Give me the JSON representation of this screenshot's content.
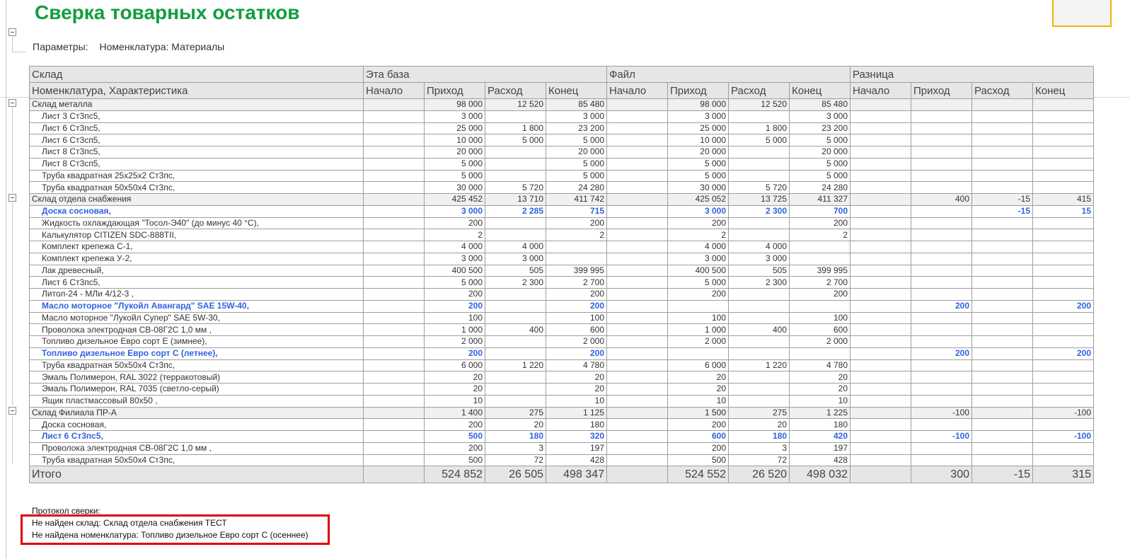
{
  "title": "Сверка товарных остатков",
  "params": {
    "label": "Параметры:",
    "value": "Номенклатура: Материалы"
  },
  "header": {
    "row1": [
      "Склад",
      "Эта база",
      "Файл",
      "Разница"
    ],
    "row2": [
      "Номенклатура, Характеристика",
      "Начало",
      "Приход",
      "Расход",
      "Конец",
      "Начало",
      "Приход",
      "Расход",
      "Конец",
      "Начало",
      "Приход",
      "Расход",
      "Конец"
    ]
  },
  "rows": [
    {
      "type": "group",
      "name": "Склад металла",
      "base": [
        "",
        "98 000",
        "12 520",
        "85 480"
      ],
      "file": [
        "",
        "98 000",
        "12 520",
        "85 480"
      ],
      "diff": [
        "",
        "",
        "",
        ""
      ]
    },
    {
      "type": "item",
      "name": "Лист 3 Ст3пс5,",
      "base": [
        "",
        "3 000",
        "",
        "3 000"
      ],
      "file": [
        "",
        "3 000",
        "",
        "3 000"
      ],
      "diff": [
        "",
        "",
        "",
        ""
      ]
    },
    {
      "type": "item",
      "name": "Лист 6 Ст3пс5,",
      "base": [
        "",
        "25 000",
        "1 800",
        "23 200"
      ],
      "file": [
        "",
        "25 000",
        "1 800",
        "23 200"
      ],
      "diff": [
        "",
        "",
        "",
        ""
      ]
    },
    {
      "type": "item",
      "name": "Лист 6 Ст3сп5,",
      "base": [
        "",
        "10 000",
        "5 000",
        "5 000"
      ],
      "file": [
        "",
        "10 000",
        "5 000",
        "5 000"
      ],
      "diff": [
        "",
        "",
        "",
        ""
      ]
    },
    {
      "type": "item",
      "name": "Лист 8 Ст3пс5,",
      "base": [
        "",
        "20 000",
        "",
        "20 000"
      ],
      "file": [
        "",
        "20 000",
        "",
        "20 000"
      ],
      "diff": [
        "",
        "",
        "",
        ""
      ]
    },
    {
      "type": "item",
      "name": "Лист 8 Ст3сп5,",
      "base": [
        "",
        "5 000",
        "",
        "5 000"
      ],
      "file": [
        "",
        "5 000",
        "",
        "5 000"
      ],
      "diff": [
        "",
        "",
        "",
        ""
      ]
    },
    {
      "type": "item",
      "name": "Труба квадратная 25х25х2 Ст3пс,",
      "base": [
        "",
        "5 000",
        "",
        "5 000"
      ],
      "file": [
        "",
        "5 000",
        "",
        "5 000"
      ],
      "diff": [
        "",
        "",
        "",
        ""
      ]
    },
    {
      "type": "item",
      "name": "Труба квадратная 50х50х4 Ст3пс,",
      "base": [
        "",
        "30 000",
        "5 720",
        "24 280"
      ],
      "file": [
        "",
        "30 000",
        "5 720",
        "24 280"
      ],
      "diff": [
        "",
        "",
        "",
        ""
      ]
    },
    {
      "type": "group",
      "name": "Склад отдела снабжения",
      "base": [
        "",
        "425 452",
        "13 710",
        "411 742"
      ],
      "file": [
        "",
        "425 052",
        "13 725",
        "411 327"
      ],
      "diff": [
        "",
        "400",
        "-15",
        "415"
      ]
    },
    {
      "type": "item",
      "hl": true,
      "name": "Доска сосновая,",
      "base": [
        "",
        "3 000",
        "2 285",
        "715"
      ],
      "file": [
        "",
        "3 000",
        "2 300",
        "700"
      ],
      "diff": [
        "",
        "",
        "-15",
        "15"
      ]
    },
    {
      "type": "item",
      "name": "Жидкость охлаждающая \"Тосол-Э40\" (до минус 40 °С),",
      "base": [
        "",
        "200",
        "",
        "200"
      ],
      "file": [
        "",
        "200",
        "",
        "200"
      ],
      "diff": [
        "",
        "",
        "",
        ""
      ]
    },
    {
      "type": "item",
      "name": "Калькулятор CITIZEN SDC-888TII,",
      "base": [
        "",
        "2",
        "",
        "2"
      ],
      "file": [
        "",
        "2",
        "",
        "2"
      ],
      "diff": [
        "",
        "",
        "",
        ""
      ]
    },
    {
      "type": "item",
      "name": "Комплект крепежа С-1,",
      "base": [
        "",
        "4 000",
        "4 000",
        ""
      ],
      "file": [
        "",
        "4 000",
        "4 000",
        ""
      ],
      "diff": [
        "",
        "",
        "",
        ""
      ]
    },
    {
      "type": "item",
      "name": "Комплект крепежа У-2,",
      "base": [
        "",
        "3 000",
        "3 000",
        ""
      ],
      "file": [
        "",
        "3 000",
        "3 000",
        ""
      ],
      "diff": [
        "",
        "",
        "",
        ""
      ]
    },
    {
      "type": "item",
      "name": "Лак древесный,",
      "base": [
        "",
        "400 500",
        "505",
        "399 995"
      ],
      "file": [
        "",
        "400 500",
        "505",
        "399 995"
      ],
      "diff": [
        "",
        "",
        "",
        ""
      ]
    },
    {
      "type": "item",
      "name": "Лист 6 Ст3пс5,",
      "base": [
        "",
        "5 000",
        "2 300",
        "2 700"
      ],
      "file": [
        "",
        "5 000",
        "2 300",
        "2 700"
      ],
      "diff": [
        "",
        "",
        "",
        ""
      ]
    },
    {
      "type": "item",
      "name": "Литол-24 - МЛи 4/12-3 ,",
      "base": [
        "",
        "200",
        "",
        "200"
      ],
      "file": [
        "",
        "200",
        "",
        "200"
      ],
      "diff": [
        "",
        "",
        "",
        ""
      ]
    },
    {
      "type": "item",
      "hl": true,
      "name": "Масло моторное \"Лукойл Авангард\" SAE 15W-40,",
      "base": [
        "",
        "200",
        "",
        "200"
      ],
      "file": [
        "",
        "",
        "",
        ""
      ],
      "diff": [
        "",
        "200",
        "",
        "200"
      ]
    },
    {
      "type": "item",
      "name": "Масло моторное \"Лукойл Супер\" SAE 5W-30,",
      "base": [
        "",
        "100",
        "",
        "100"
      ],
      "file": [
        "",
        "100",
        "",
        "100"
      ],
      "diff": [
        "",
        "",
        "",
        ""
      ]
    },
    {
      "type": "item",
      "name": "Проволока электродная СВ-08Г2С 1,0 мм ,",
      "base": [
        "",
        "1 000",
        "400",
        "600"
      ],
      "file": [
        "",
        "1 000",
        "400",
        "600"
      ],
      "diff": [
        "",
        "",
        "",
        ""
      ]
    },
    {
      "type": "item",
      "name": "Топливо дизельное Евро сорт Е (зимнее),",
      "base": [
        "",
        "2 000",
        "",
        "2 000"
      ],
      "file": [
        "",
        "2 000",
        "",
        "2 000"
      ],
      "diff": [
        "",
        "",
        "",
        ""
      ]
    },
    {
      "type": "item",
      "hl": true,
      "name": "Топливо дизельное Евро сорт С (летнее),",
      "base": [
        "",
        "200",
        "",
        "200"
      ],
      "file": [
        "",
        "",
        "",
        ""
      ],
      "diff": [
        "",
        "200",
        "",
        "200"
      ]
    },
    {
      "type": "item",
      "name": "Труба квадратная 50х50х4 Ст3пс,",
      "base": [
        "",
        "6 000",
        "1 220",
        "4 780"
      ],
      "file": [
        "",
        "6 000",
        "1 220",
        "4 780"
      ],
      "diff": [
        "",
        "",
        "",
        ""
      ]
    },
    {
      "type": "item",
      "name": "Эмаль Полимерон, RAL 3022 (терракотовый)",
      "base": [
        "",
        "20",
        "",
        "20"
      ],
      "file": [
        "",
        "20",
        "",
        "20"
      ],
      "diff": [
        "",
        "",
        "",
        ""
      ]
    },
    {
      "type": "item",
      "name": "Эмаль Полимерон, RAL 7035 (светло-серый)",
      "base": [
        "",
        "20",
        "",
        "20"
      ],
      "file": [
        "",
        "20",
        "",
        "20"
      ],
      "diff": [
        "",
        "",
        "",
        ""
      ]
    },
    {
      "type": "item",
      "name": "Ящик пластмассовый 80х50 ,",
      "base": [
        "",
        "10",
        "",
        "10"
      ],
      "file": [
        "",
        "10",
        "",
        "10"
      ],
      "diff": [
        "",
        "",
        "",
        ""
      ]
    },
    {
      "type": "group",
      "name": "Склад Филиала ПР-А",
      "base": [
        "",
        "1 400",
        "275",
        "1 125"
      ],
      "file": [
        "",
        "1 500",
        "275",
        "1 225"
      ],
      "diff": [
        "",
        "-100",
        "",
        "-100"
      ]
    },
    {
      "type": "item",
      "name": "Доска сосновая,",
      "base": [
        "",
        "200",
        "20",
        "180"
      ],
      "file": [
        "",
        "200",
        "20",
        "180"
      ],
      "diff": [
        "",
        "",
        "",
        ""
      ]
    },
    {
      "type": "item",
      "hl": true,
      "name": "Лист 6 Ст3пс5,",
      "base": [
        "",
        "500",
        "180",
        "320"
      ],
      "file": [
        "",
        "600",
        "180",
        "420"
      ],
      "diff": [
        "",
        "-100",
        "",
        "-100"
      ]
    },
    {
      "type": "item",
      "name": "Проволока электродная СВ-08Г2С 1,0 мм ,",
      "base": [
        "",
        "200",
        "3",
        "197"
      ],
      "file": [
        "",
        "200",
        "3",
        "197"
      ],
      "diff": [
        "",
        "",
        "",
        ""
      ]
    },
    {
      "type": "item",
      "name": "Труба квадратная 50х50х4 Ст3пс,",
      "base": [
        "",
        "500",
        "72",
        "428"
      ],
      "file": [
        "",
        "500",
        "72",
        "428"
      ],
      "diff": [
        "",
        "",
        "",
        ""
      ]
    }
  ],
  "total": {
    "name": "Итого",
    "base": [
      "",
      "524 852",
      "26 505",
      "498 347"
    ],
    "file": [
      "",
      "524 552",
      "26 520",
      "498 032"
    ],
    "diff": [
      "",
      "300",
      "-15",
      "315"
    ]
  },
  "protocol": {
    "title": "Протокол сверки:",
    "lines": [
      "Не найден склад: Склад отдела снабжения ТЕСТ",
      "Не найдена номенклатура: Топливо дизельное Евро сорт С (осеннее)"
    ]
  },
  "colors": {
    "title": "#129e3e",
    "highlight": "#2f63e0",
    "protocol_border": "#e00000",
    "header_bg": "#e6e6e6"
  }
}
